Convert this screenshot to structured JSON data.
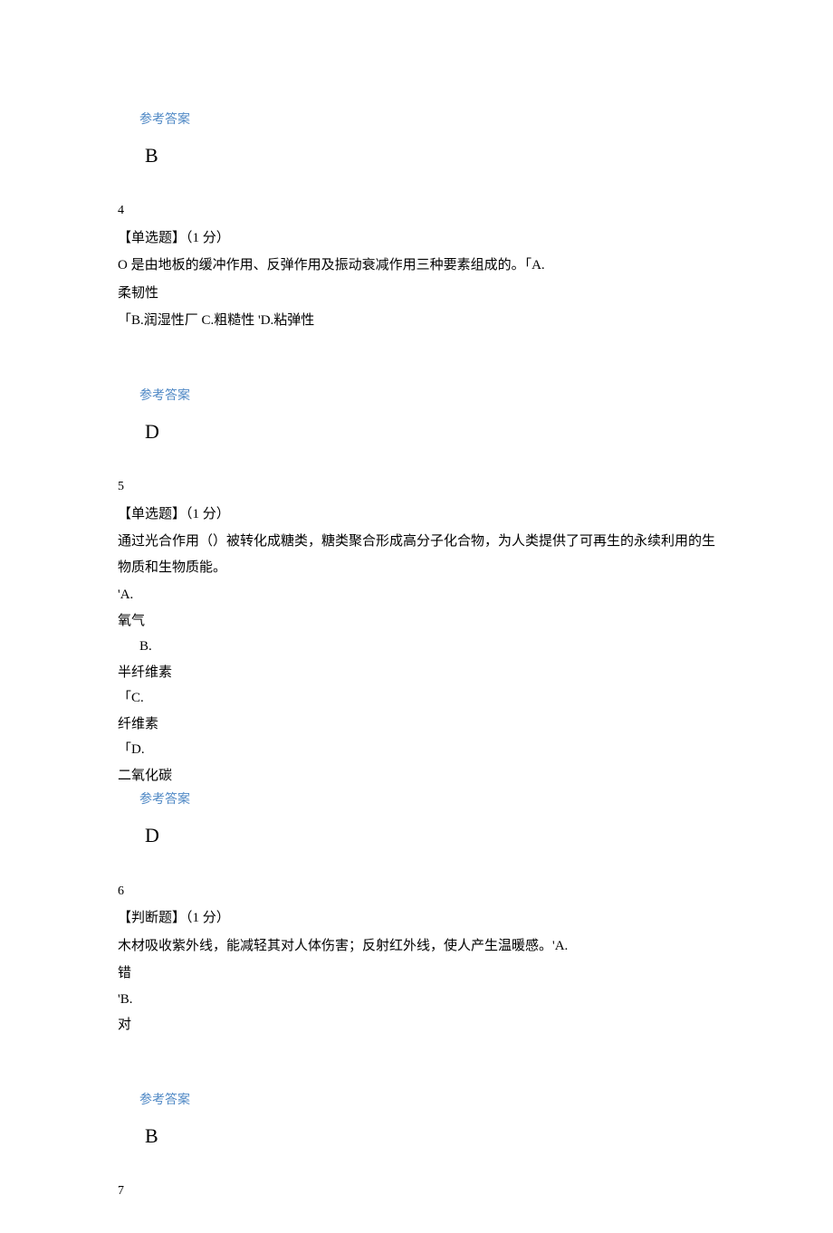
{
  "labels": {
    "ref_answer": "参考答案"
  },
  "q3": {
    "answer": "B"
  },
  "q4": {
    "num": "4",
    "type": "【单选题】（1 分）",
    "text1": "O 是由地板的缓冲作用、反弹作用及振动衰减作用三种要素组成的。「A.",
    "text2": "柔韧性",
    "opts": "「B.润湿性厂 C.粗糙性 'D.粘弹性",
    "answer": "D"
  },
  "q5": {
    "num": "5",
    "type": "【单选题】（1 分）",
    "text1": "通过光合作用（）被转化成糖类，糖类聚合形成高分子化合物，为人类提供了可再生的永续利用的生物质和生物质能。",
    "optA_mark": "'A.",
    "optA_text": "氧气",
    "optB_mark": "B.",
    "optB_text": "半纤维素",
    "optC_mark": "「C.",
    "optC_text": "纤维素",
    "optD_mark": "「D.",
    "optD_text": "二氧化碳",
    "answer": "D"
  },
  "q6": {
    "num": "6",
    "type": "【判断题】（1 分）",
    "text1": "木材吸收紫外线，能减轻其对人体伤害；反射红外线，使人产生温暖感。'A.",
    "optA_text": "错",
    "optB_mark": "'B.",
    "optB_text": "对",
    "answer": "B"
  },
  "q7": {
    "num": "7"
  }
}
